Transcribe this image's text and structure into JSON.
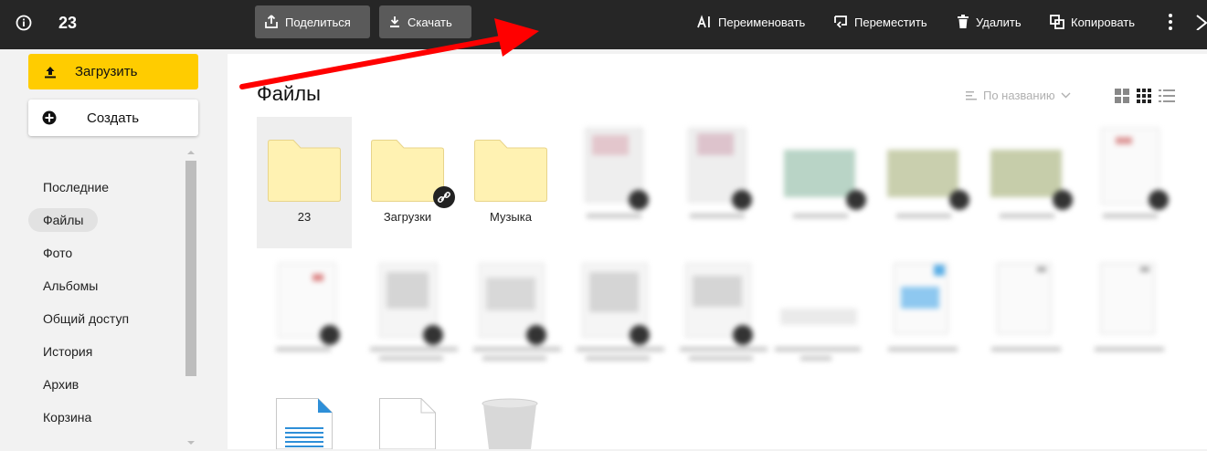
{
  "topbar": {
    "count": "23",
    "share_label": "Поделиться",
    "download_label": "Скачать",
    "rename_label": "Переименовать",
    "move_label": "Переместить",
    "delete_label": "Удалить",
    "copy_label": "Копировать"
  },
  "sidebar": {
    "upload_label": "Загрузить",
    "create_label": "Создать",
    "items": [
      {
        "label": "Последние"
      },
      {
        "label": "Файлы"
      },
      {
        "label": "Фото"
      },
      {
        "label": "Альбомы"
      },
      {
        "label": "Общий доступ"
      },
      {
        "label": "История"
      },
      {
        "label": "Архив"
      },
      {
        "label": "Корзина"
      }
    ]
  },
  "main": {
    "title": "Файлы",
    "sort_label": "По названию",
    "folders": [
      {
        "label": "23"
      },
      {
        "label": "Загрузки"
      },
      {
        "label": "Музыка"
      }
    ]
  },
  "colors": {
    "topbar_bg": "#262626",
    "upload_btn": "#ffcc00",
    "folder_fill": "#fff2b2",
    "annotation_arrow": "#ff0000"
  }
}
